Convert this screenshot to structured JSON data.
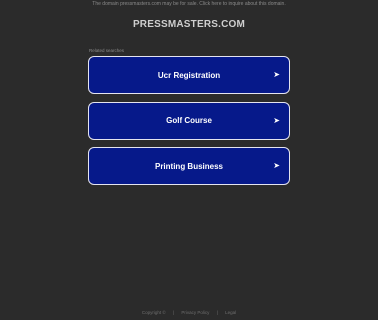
{
  "notice": "The domain pressmasters.com may be for sale. Click here to inquire about this domain.",
  "domain": "PRESSMASTERS.COM",
  "related_label": "Related searches",
  "links": [
    {
      "label": "Ucr Registration"
    },
    {
      "label": "Golf Course"
    },
    {
      "label": "Printing Business"
    }
  ],
  "arrow_glyph": "➤",
  "footer": {
    "copyright": "Copyright ©",
    "privacy": "Privacy Policy",
    "separator": "|",
    "legal": "Legal"
  },
  "colors": {
    "background": "#2b2b2b",
    "link_box": "#06198a",
    "link_border": "#e4e4ef"
  }
}
